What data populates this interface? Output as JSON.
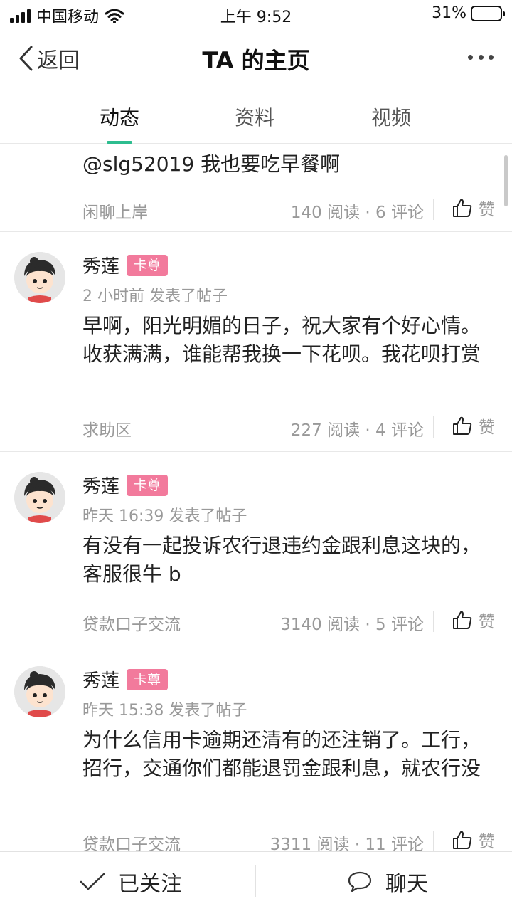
{
  "status_bar": {
    "carrier": "中国移动",
    "time": "上午 9:52",
    "battery": "31%",
    "battery_level": 0.31
  },
  "nav": {
    "back_label": "返回",
    "title": "TA 的主页"
  },
  "tabs": [
    {
      "label": "动态",
      "active": true
    },
    {
      "label": "资料",
      "active": false
    },
    {
      "label": "视频",
      "active": false
    }
  ],
  "posts": [
    {
      "content": "@slg52019 我也要吃早餐啊",
      "category": "闲聊上岸",
      "stats": "140 阅读 · 6 评论",
      "like_label": "赞"
    },
    {
      "author": "秀莲",
      "badge": "卡尊",
      "time": "2 小时前 发表了帖子",
      "content": "早啊，阳光明媚的日子，祝大家有个好心情。收获满满，谁能帮我换一下花呗。我花呗打赏",
      "category": "求助区",
      "stats": "227 阅读 · 4 评论",
      "like_label": "赞"
    },
    {
      "author": "秀莲",
      "badge": "卡尊",
      "time": "昨天 16:39 发表了帖子",
      "content": "有没有一起投诉农行退违约金跟利息这块的，客服很牛 b",
      "category": "贷款口子交流",
      "stats": "3140 阅读 · 5 评论",
      "like_label": "赞"
    },
    {
      "author": "秀莲",
      "badge": "卡尊",
      "time": "昨天 15:38 发表了帖子",
      "content": "为什么信用卡逾期还清有的还注销了。工行，招行，交通你们都能退罚金跟利息，就农行没",
      "category": "贷款口子交流",
      "stats": "3311 阅读 · 11 评论",
      "like_label": "赞"
    }
  ],
  "bottom_bar": {
    "follow_label": "已关注",
    "chat_label": "聊天"
  },
  "colors": {
    "accent": "#2dbd8f",
    "badge": "#f27a9c",
    "muted": "#999999"
  }
}
